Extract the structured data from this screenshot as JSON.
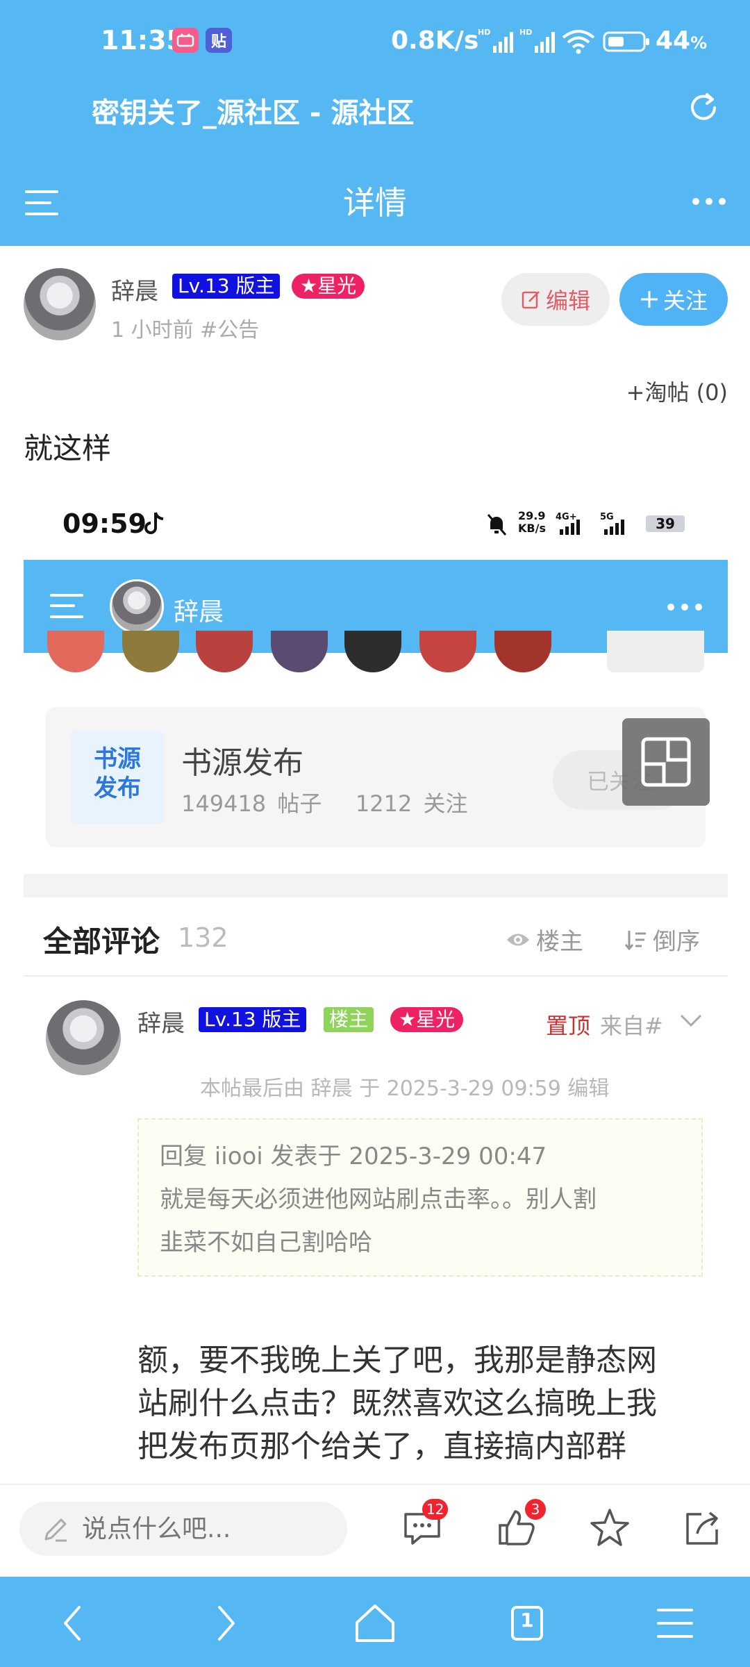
{
  "status_bar": {
    "time": "11:35",
    "net_speed": "0.8K/s",
    "battery": "44",
    "battery_unit": "%",
    "app_badges": [
      "bilibili",
      "贴"
    ]
  },
  "browser": {
    "page_title": "密钥关了_源社区 - 源社区"
  },
  "nav": {
    "title": "详情"
  },
  "post": {
    "author": "辞晨",
    "level_tag": "Lv.13 版主",
    "star_tag": "★星光",
    "meta": "1 小时前 #公告",
    "edit_label": "编辑",
    "follow_label": "关注",
    "taotie": "+淘帖 (0)",
    "body": "就这样"
  },
  "embedded": {
    "time": "09:59",
    "net": "29.9 KB/s",
    "battery": "39",
    "user": "辞晨",
    "forum_name": "书源发布",
    "forum_logo_text": [
      "书源",
      "发布"
    ],
    "forum_posts": "149418 帖子",
    "forum_follows": "1212 关注",
    "followed_label": "已关注"
  },
  "comments": {
    "title": "全部评论",
    "count": "132",
    "filter_owner": "楼主",
    "sort": "倒序",
    "first": {
      "author": "辞晨",
      "level_tag": "Lv.13 版主",
      "owner_tag": "楼主",
      "star_tag": "★星光",
      "pinned": "置顶",
      "from": "来自#",
      "edited": "本帖最后由 辞晨 于 2025-3-29 09:59 编辑",
      "quote_line1": "回复 iiooi 发表于 2025-3-29 00:47",
      "quote_line2": "就是每天必须进他网站刷点击率。。别人割",
      "quote_line3": "韭菜不如自己割哈哈",
      "reply_line1": "额，要不我晚上关了吧，我那是静态网",
      "reply_line2": "站刷什么点击？既然喜欢这么搞晚上我",
      "reply_line3": "把发布页那个给关了，直接搞内部群"
    }
  },
  "input_bar": {
    "placeholder": "说点什么吧...",
    "comment_badge": "12",
    "like_badge": "3"
  },
  "browser_nav": {
    "tab_count": "1"
  },
  "colors": {
    "primary": "#56b8f2",
    "accent_red": "#f0232f",
    "level_blue": "#1212e0",
    "star_pink": "#ee2263",
    "owner_green": "#8fd45a"
  }
}
